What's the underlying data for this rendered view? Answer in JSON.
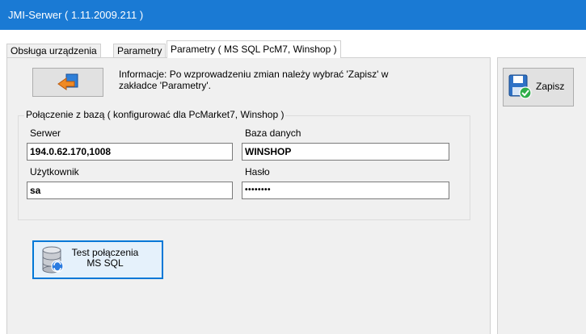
{
  "window": {
    "title": "JMI-Serwer ( 1.11.2009.211 )"
  },
  "tabs": [
    {
      "label": "Obsługa urządzenia"
    },
    {
      "label": "Parametry"
    },
    {
      "label": "Parametry ( MS SQL PcM7, Winshop )"
    }
  ],
  "info": {
    "text": "Informacje: Po wzprowadzeniu zmian należy wybrać 'Zapisz' w zakładce 'Parametry'."
  },
  "connection_group": {
    "legend": "Połączenie z bazą ( konfigurować dla PcMarket7, Winshop )",
    "server_label": "Serwer",
    "server_value": "194.0.62.170,1008",
    "database_label": "Baza danych",
    "database_value": "WINSHOP",
    "user_label": "Użytkownik",
    "user_value": "sa",
    "password_label": "Hasło",
    "password_value": "••••••••"
  },
  "test_button": {
    "label": "Test połączenia MS SQL"
  },
  "save_button": {
    "label": "Zapisz"
  },
  "icons": {
    "back": "back-arrow-icon",
    "database": "database-icon",
    "save": "floppy-save-icon"
  },
  "colors": {
    "titlebar": "#1a7ad4",
    "focus": "#0078d7",
    "panel": "#f0f0f0"
  }
}
